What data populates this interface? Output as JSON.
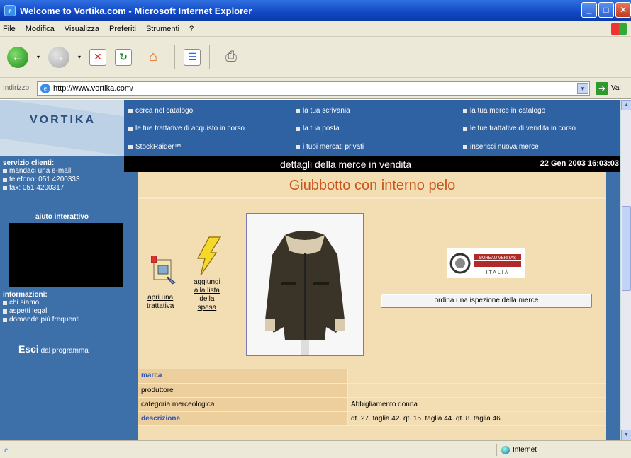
{
  "window": {
    "title": "Welcome to Vortika.com - Microsoft Internet Explorer",
    "minimize": "_",
    "maximize": "□",
    "close": "✕"
  },
  "menu": [
    "File",
    "Modifica",
    "Visualizza",
    "Preferiti",
    "Strumenti",
    "?"
  ],
  "address": {
    "label": "Indirizzo",
    "url": "http://www.vortika.com/",
    "go_label": "Vai"
  },
  "logo": "VORTIKA",
  "nav": [
    "cerca nel catalogo",
    "la tua scrivania",
    "la tua merce in catalogo",
    "le tue trattative di acquisto in corso",
    "la tua posta",
    "le tue trattative di vendita in corso",
    "StockRaider™",
    "i tuoi mercati privati",
    "inserisci nuova merce"
  ],
  "sidebar": {
    "customer_service_title": "servizio clienti:",
    "customer_service": [
      "mandaci una e-mail",
      "telefono: 051 4200333",
      "fax: 051 4200317"
    ],
    "help_title": "aiuto interattivo",
    "info_title": "informazioni:",
    "info": [
      "chi siamo",
      "aspetti legali",
      "domande più frequenti"
    ],
    "exit_bold": "Esci",
    "exit_rest": " dal programma"
  },
  "header": {
    "section_title": "dettagli della merce in vendita",
    "datetime": "22 Gen 2003  16:03:03"
  },
  "product": {
    "title": "Giubbotto con interno pelo",
    "open_negotiation_l1": "apri una",
    "open_negotiation_l2": "trattativa",
    "add_to_list_l1": "aggiungi",
    "add_to_list_l2": "alla lista",
    "add_to_list_l3": "della",
    "add_to_list_l4": "spesa",
    "inspection_button": "ordina una ispezione della merce",
    "bv_name": "BUREAU VERITAS",
    "bv_sub": "ITALIA"
  },
  "details": [
    {
      "label": "marca",
      "value": "",
      "highlight": true
    },
    {
      "label": "produttore",
      "value": "",
      "highlight": false
    },
    {
      "label": "categoria merceologica",
      "value": "Abbigliamento donna",
      "highlight": false
    },
    {
      "label": "descrizione",
      "value": "qt. 27. taglia 42. qt. 15. taglia 44. qt. 8. taglia 46.",
      "highlight": true
    }
  ],
  "status": {
    "zone": "Internet"
  },
  "colors": {
    "nav_bg": "#2f62a3",
    "side_bg": "#3d70a8",
    "panel_bg": "#f3ddb3",
    "title_color": "#c8561a"
  }
}
